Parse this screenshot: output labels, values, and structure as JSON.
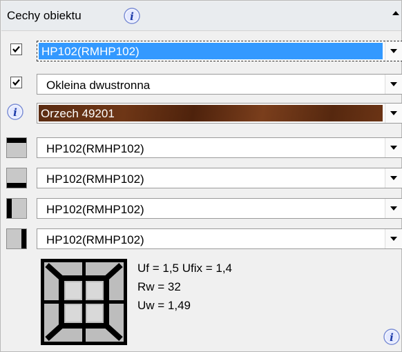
{
  "header": {
    "title": "Cechy obiektu"
  },
  "rows": [
    {
      "type": "checkbox",
      "checked": true,
      "value": "HP102(RMHP102)",
      "style": "selected"
    },
    {
      "type": "checkbox",
      "checked": true,
      "value": "Okleina dwustronna",
      "style": "normal"
    },
    {
      "type": "info",
      "value": "Orzech 49201",
      "style": "wood"
    },
    {
      "type": "edge-top",
      "value": "HP102(RMHP102)"
    },
    {
      "type": "edge-bottom",
      "value": "HP102(RMHP102)"
    },
    {
      "type": "edge-left",
      "value": "HP102(RMHP102)"
    },
    {
      "type": "edge-right",
      "value": "HP102(RMHP102)"
    }
  ],
  "properties": {
    "line1": "Uf = 1,5  Ufix = 1,4",
    "line2": "Rw = 32",
    "line3": "Uw = 1,49"
  },
  "colors": {
    "selection": "#3399ff",
    "wood": "#5b2c12"
  }
}
